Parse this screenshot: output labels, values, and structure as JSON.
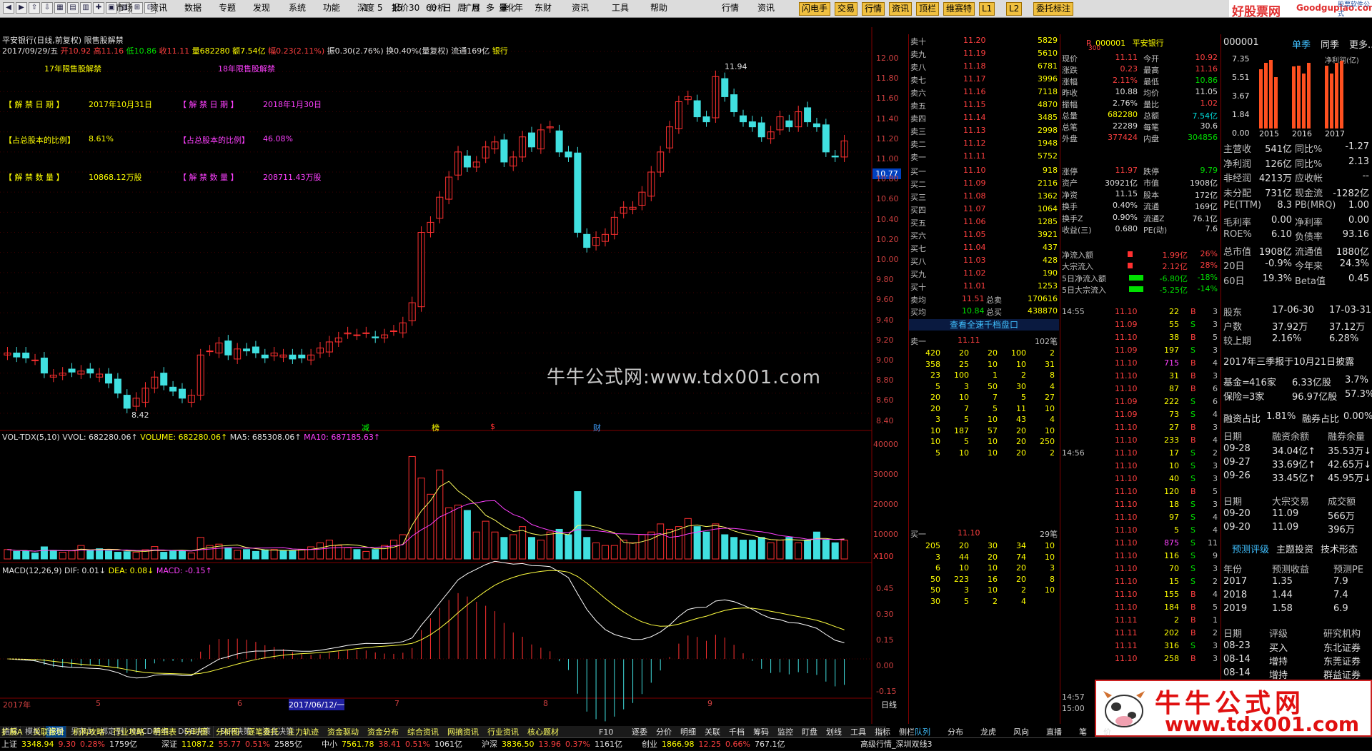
{
  "toolbar": {
    "menu": [
      "市场",
      "资讯",
      "数据",
      "专题",
      "发现",
      "系统",
      "功能",
      "深度",
      "报价",
      "分析",
      "扩展",
      "量化",
      "东财",
      "资讯",
      "工具",
      "帮助"
    ],
    "periods": [
      "1",
      "5",
      "15",
      "30",
      "60",
      "日",
      "周",
      "月",
      "多",
      "季",
      "年"
    ],
    "right_menu": [
      "行情",
      "资讯"
    ],
    "buttons": [
      "闪电手",
      "交易",
      "行情",
      "资讯",
      "顶栏",
      "维赛特",
      "L1",
      "L2",
      "委托标注"
    ],
    "logo_text": "好股票网",
    "logo_domain": "Goodgupiao.com",
    "logo_suffix": "股票软件公式"
  },
  "chart": {
    "title": "平安银行(日线,前复权) 限售股解禁",
    "info_line": {
      "date": "2017/09/29/五",
      "open": "开10.92",
      "high": "高11.16",
      "low": "低10.86",
      "close": "收11.11",
      "vol": "量682280",
      "amount": "额7.54亿",
      "change_amt": "幅0.23(2.11%)",
      "amp": "振0.30(2.76%)",
      "turnover": "换0.40%(量复权)",
      "float": "流通169亿",
      "sector": "银行"
    },
    "labels": {
      "l17": "17年限售股解禁",
      "l18": "18年限售股解禁"
    },
    "info_rows": [
      {
        "k1": "【 解 禁 日 期 】",
        "v1": "2017年10月31日",
        "k2": "【 解 禁 日 期 】",
        "v2": "2018年1月30日"
      },
      {
        "k1": "【占总股本的比例】",
        "v1": "8.61%",
        "k2": "【占总股本的比例】",
        "v2": "46.08%"
      },
      {
        "k1": "【 解 禁 数 量 】",
        "v1": "10868.12万股",
        "k2": "【 解 禁 数 量 】",
        "v2": "208711.43万股"
      }
    ],
    "watermark": "牛牛公式网:www.tdx001.com",
    "max_label": "11.94",
    "min_label": "8.42",
    "price_tag": "10.77",
    "price_axis": [
      "12.00",
      "11.80",
      "11.60",
      "11.40",
      "11.20",
      "11.00",
      "10.80",
      "10.60",
      "10.40",
      "10.20",
      "10.00",
      "9.80",
      "9.60",
      "9.40",
      "9.20",
      "9.00",
      "8.80",
      "8.60",
      "8.40"
    ],
    "event_marks": [
      {
        "t": "减",
        "c": "#00ff00"
      },
      {
        "t": "榜",
        "c": "#ffff00"
      },
      {
        "t": "$",
        "c": "#ff3030"
      },
      {
        "t": "财",
        "c": "#40a0ff"
      }
    ],
    "vol_header": {
      "name": "VOL-TDX(5,10)",
      "vvol": "VVOL: 682280.06↑",
      "volume": "VOLUME: 682280.06↑",
      "ma5": "MA5: 685308.06↑",
      "ma10": "MA10: 687185.63↑"
    },
    "vol_axis": [
      "40000",
      "30000",
      "20000",
      "10000"
    ],
    "vol_unit": "X100",
    "macd_header": {
      "name": "MACD(12,26,9)",
      "dif": "DIF: 0.01↓",
      "dea": "DEA: 0.08↓",
      "macd": "MACD: -0.15↑"
    },
    "macd_axis": [
      "0.45",
      "0.30",
      "0.15",
      "0.00",
      "-0.15"
    ],
    "date_axis": [
      "2017年",
      "5",
      "6",
      "2017/06/12/一",
      "7",
      "8",
      "9"
    ],
    "date_label": "日线"
  },
  "chart_data": {
    "type": "candlestick",
    "series": [
      {
        "name": "price",
        "close_series": [
          9.0,
          8.96,
          8.95,
          8.93,
          8.8,
          8.78,
          8.8,
          8.81,
          8.82,
          8.8,
          8.79,
          8.7,
          8.6,
          8.45,
          8.55,
          8.65,
          8.76,
          8.68,
          8.62,
          8.55,
          8.58,
          8.98,
          9.02,
          9.1,
          8.98,
          9.04,
          9.02,
          9.0,
          8.95,
          9.0,
          8.98,
          8.94,
          8.95,
          8.98,
          9.05,
          9.11,
          9.15,
          9.2,
          9.18,
          9.2,
          9.15,
          9.18,
          9.22,
          9.3,
          9.5,
          10.2,
          10.3,
          10.55,
          10.75,
          11.0,
          10.85,
          10.9,
          11.05,
          11.1,
          10.9,
          10.95,
          11.15,
          11.05,
          11.22,
          11.25,
          11.0,
          10.95,
          10.2,
          10.05,
          10.15,
          10.18,
          10.35,
          10.45,
          10.45,
          10.6,
          10.8,
          11.0,
          11.25,
          11.5,
          11.55,
          11.35,
          11.3,
          11.75,
          11.55,
          11.4,
          11.3,
          11.25,
          11.15,
          11.2,
          11.35,
          11.25,
          11.4,
          11.3,
          11.25,
          11.0,
          10.95,
          11.11
        ]
      }
    ],
    "volume_x100": [
      3500,
      2800,
      3000,
      2200,
      4500,
      3200,
      2500,
      3000,
      5000,
      3300,
      3800,
      3000,
      2500,
      2700,
      2500,
      3400,
      4600,
      2500,
      3000,
      2900,
      2200,
      8000,
      5000,
      5500,
      4200,
      3200,
      3500,
      2800,
      3300,
      3500,
      3000,
      3200,
      3600,
      4500,
      6000,
      7000,
      5000,
      4200,
      3500,
      2800,
      3500,
      5000,
      7000,
      9000,
      38000,
      30000,
      24000,
      33000,
      19000,
      20000,
      18000,
      10000,
      14000,
      10000,
      8000,
      9000,
      12000,
      8000,
      7000,
      10000,
      11000,
      9000,
      25000,
      8000,
      6000,
      5000,
      5000,
      7000,
      6000,
      9000,
      10000,
      13000,
      11000,
      12000,
      15000,
      12000,
      10000,
      13000,
      9000,
      8000,
      7000,
      7000,
      8000,
      6000,
      7000,
      8000,
      6000,
      7000,
      10000,
      7000,
      6000,
      7000
    ],
    "macd_y_range": [
      -0.2,
      0.5
    ],
    "volume_y_range": [
      0,
      45000
    ],
    "price_y_range": [
      8.3,
      12.1
    ]
  },
  "quote": {
    "code": "000001",
    "name": "平安银行",
    "code_prefix": "R",
    "code_sub": "300",
    "asks": [
      [
        "卖十",
        "11.20",
        "5829"
      ],
      [
        "卖九",
        "11.19",
        "5610"
      ],
      [
        "卖八",
        "11.18",
        "6781"
      ],
      [
        "卖七",
        "11.17",
        "3996"
      ],
      [
        "卖六",
        "11.16",
        "7118"
      ],
      [
        "卖五",
        "11.15",
        "4870"
      ],
      [
        "卖四",
        "11.14",
        "3485"
      ],
      [
        "卖三",
        "11.13",
        "2998"
      ],
      [
        "卖二",
        "11.12",
        "1948"
      ],
      [
        "卖一",
        "11.11",
        "5752"
      ]
    ],
    "bids": [
      [
        "买一",
        "11.10",
        "918"
      ],
      [
        "买二",
        "11.09",
        "2116"
      ],
      [
        "买三",
        "11.08",
        "1362"
      ],
      [
        "买四",
        "11.07",
        "1064"
      ],
      [
        "买五",
        "11.06",
        "1285"
      ],
      [
        "买六",
        "11.05",
        "3921"
      ],
      [
        "买七",
        "11.04",
        "437"
      ],
      [
        "买八",
        "11.03",
        "428"
      ],
      [
        "买九",
        "11.02",
        "190"
      ],
      [
        "买十",
        "11.01",
        "1253"
      ]
    ],
    "avg": [
      [
        "卖均",
        "11.51",
        "总卖",
        "170616"
      ],
      [
        "买均",
        "10.84",
        "总买",
        "438870"
      ]
    ],
    "link": "查看全速千档盘口",
    "q1_head": [
      "卖一",
      "11.11",
      "102笔"
    ],
    "q1_rows": [
      [
        "420",
        "20",
        "20",
        "100",
        "2"
      ],
      [
        "358",
        "25",
        "10",
        "10",
        "31"
      ],
      [
        "23",
        "100",
        "1",
        "2",
        "8"
      ],
      [
        "5",
        "3",
        "50",
        "30",
        "4"
      ],
      [
        "20",
        "10",
        "7",
        "5",
        "27"
      ],
      [
        "20",
        "7",
        "5",
        "11",
        "10"
      ],
      [
        "3",
        "5",
        "10",
        "43",
        "4"
      ],
      [
        "10",
        "187",
        "57",
        "20",
        "10"
      ],
      [
        "10",
        "5",
        "10",
        "20",
        "250"
      ],
      [
        "5",
        "10",
        "10",
        "20",
        "2"
      ]
    ],
    "q2_head": [
      "买一",
      "11.10",
      "29笔"
    ],
    "q2_rows": [
      [
        "205",
        "20",
        "30",
        "34",
        "10"
      ],
      [
        "3",
        "44",
        "20",
        "74",
        "10"
      ],
      [
        "6",
        "10",
        "10",
        "20",
        "3"
      ],
      [
        "50",
        "223",
        "16",
        "20",
        "8"
      ],
      [
        "50",
        "3",
        "10",
        "2",
        "10"
      ],
      [
        "30",
        "5",
        "2",
        "4",
        ""
      ]
    ]
  },
  "stats": [
    [
      "现价",
      "11.11",
      "今开",
      "10.92"
    ],
    [
      "涨跌",
      "0.23",
      "最高",
      "11.16"
    ],
    [
      "涨幅",
      "2.11%",
      "最低",
      "10.86"
    ],
    [
      "昨收",
      "10.88",
      "均价",
      "11.05"
    ],
    [
      "振幅",
      "2.76%",
      "量比",
      "1.02"
    ],
    [
      "总量",
      "682280",
      "总额",
      "7.54亿"
    ],
    [
      "总笔",
      "22289",
      "每笔",
      "30.6"
    ],
    [
      "外盘",
      "377424",
      "内盘",
      "304856"
    ],
    [
      "涨停",
      "11.97",
      "跌停",
      "9.79"
    ],
    [
      "资产",
      "30921亿",
      "市值",
      "1908亿"
    ],
    [
      "净资",
      "11.15",
      "股本",
      "172亿"
    ],
    [
      "换手",
      "0.40%",
      "流通",
      "169亿"
    ],
    [
      "换手Z",
      "0.90%",
      "流通Z",
      "76.1亿"
    ],
    [
      "收益(三)",
      "0.680",
      "PE(动)",
      "7.6"
    ]
  ],
  "flows": [
    [
      "净流入额",
      "1.99亿",
      "26%"
    ],
    [
      "大宗流入",
      "2.12亿",
      "28%"
    ],
    [
      "5日净流入额",
      "-6.80亿",
      "-18%"
    ],
    [
      "5日大宗流入",
      "-5.25亿",
      "-14%"
    ]
  ],
  "ticks": {
    "t1": "14:55",
    "t2": "14:56",
    "t3": "14:57",
    "t4": "15:00",
    "rows": [
      [
        "11.10",
        "22",
        "B",
        "3"
      ],
      [
        "11.09",
        "55",
        "S",
        "3"
      ],
      [
        "11.10",
        "38",
        "B",
        "5"
      ],
      [
        "11.09",
        "197",
        "S",
        "3"
      ],
      [
        "11.10",
        "715",
        "B",
        "4"
      ],
      [
        "11.10",
        "31",
        "B",
        "3"
      ],
      [
        "11.10",
        "87",
        "B",
        "6"
      ],
      [
        "11.09",
        "222",
        "S",
        "6"
      ],
      [
        "11.09",
        "73",
        "S",
        "4"
      ],
      [
        "11.10",
        "27",
        "B",
        "3"
      ],
      [
        "11.10",
        "233",
        "B",
        "4"
      ],
      [
        "11.10",
        "17",
        "S",
        "2"
      ],
      [
        "11.10",
        "10",
        "S",
        "3"
      ],
      [
        "11.10",
        "40",
        "S",
        "3"
      ],
      [
        "11.10",
        "120",
        "B",
        "5"
      ],
      [
        "11.10",
        "18",
        "S",
        "3"
      ],
      [
        "11.10",
        "97",
        "S",
        "4"
      ],
      [
        "11.10",
        "5",
        "S",
        "4"
      ],
      [
        "11.10",
        "875",
        "S",
        "11"
      ],
      [
        "11.10",
        "116",
        "S",
        "9"
      ],
      [
        "11.10",
        "70",
        "S",
        "3"
      ],
      [
        "11.10",
        "15",
        "S",
        "2"
      ],
      [
        "11.10",
        "155",
        "B",
        "4"
      ],
      [
        "11.10",
        "184",
        "B",
        "5"
      ],
      [
        "11.11",
        "2",
        "B",
        "1"
      ],
      [
        "11.11",
        "202",
        "B",
        "2"
      ],
      [
        "11.11",
        "316",
        "S",
        "3"
      ],
      [
        "11.10",
        "258",
        "B",
        "3"
      ]
    ]
  },
  "f10": {
    "code": "000001",
    "tabs": [
      "单季",
      "同季",
      "更多.."
    ],
    "bar_axis": [
      "7.35",
      "5.51",
      "3.67",
      "1.84",
      "0.00"
    ],
    "bar_legend": "净利润(亿)",
    "bar_years": [
      "2015",
      "2016",
      "2017"
    ],
    "bar_values": [
      6.2,
      6.9,
      7.2,
      5.4,
      6.5,
      6.6,
      5.8,
      6.9,
      6.6,
      5.8,
      6.9,
      7.1
    ],
    "fin": [
      [
        "主营收",
        "541亿",
        "同比%",
        "-1.27"
      ],
      [
        "净利润",
        "126亿",
        "同比%",
        "2.13"
      ],
      [
        "非经润",
        "4213万",
        "应收帐",
        "--"
      ],
      [
        "未分配",
        "731亿",
        "现金流",
        "-1282亿"
      ],
      [
        "PE(TTM)",
        "8.3",
        "PB(MRQ)",
        "1.00"
      ],
      [
        "毛利率",
        "0.00",
        "净利率",
        "0.00"
      ],
      [
        "ROE%",
        "6.10",
        "负债率",
        "93.16"
      ],
      [
        "总市值",
        "1908亿",
        "流通值",
        "1880亿"
      ],
      [
        "20日",
        "-0.9%",
        "今年来",
        "24.3%"
      ],
      [
        "60日",
        "19.3%",
        "Beta值",
        "0.45"
      ]
    ],
    "holders": [
      [
        "股东",
        "17-06-30",
        "17-03-31"
      ],
      [
        "户数",
        "37.92万",
        "37.12万"
      ],
      [
        "较上期",
        "2.16%",
        "6.28%"
      ]
    ],
    "report": "2017年三季报于10月21日披露",
    "funds": [
      [
        "基金=",
        "416家",
        "6.33亿股",
        "3.7%"
      ],
      [
        "保险=",
        "3家",
        "96.97亿股",
        "57.3%"
      ]
    ],
    "margin_ratio": [
      "融资占比",
      "1.81%",
      "融券占比",
      "0.00%"
    ],
    "margin_head": [
      "日期",
      "融资余额",
      "融券余量"
    ],
    "margin": [
      [
        "09-28",
        "34.04亿↑",
        "35.53万↓"
      ],
      [
        "09-27",
        "33.69亿↑",
        "42.65万↓"
      ],
      [
        "09-26",
        "33.45亿↑",
        "45.95万↓"
      ]
    ],
    "block_head": [
      "日期",
      "大宗交易",
      "成交额"
    ],
    "block": [
      [
        "09-20",
        "11.09",
        "566万"
      ],
      [
        "09-20",
        "11.09",
        "396万"
      ]
    ],
    "tabs2": [
      "预测评级",
      "主题投资",
      "技术形态"
    ],
    "fc_head": [
      "年份",
      "预测收益",
      "预测PE"
    ],
    "fc": [
      [
        "2017",
        "1.35",
        "7.9"
      ],
      [
        "2018",
        "1.44",
        "7.4"
      ],
      [
        "2019",
        "1.58",
        "6.9"
      ]
    ],
    "rt_head": [
      "日期",
      "评级",
      "研究机构"
    ],
    "rt": [
      [
        "08-23",
        "买入",
        "东北证券"
      ],
      [
        "08-14",
        "增持",
        "东莞证券"
      ],
      [
        "08-14",
        "增持",
        "群益证券"
      ]
    ]
  },
  "bottom_tabs1": [
    "指标",
    "模板",
    "管理",
    "另存为",
    "绑定到",
    "MACD基本",
    "DDE决策",
    "SUP决策",
    "资金决策"
  ],
  "bottom_tabs2": [
    "扩展A",
    "关联报价",
    "机构攻略",
    "行业攻略",
    "明细表",
    "分时图",
    "分析图",
    "逐笔委托",
    "主力轨迹",
    "资金驱动",
    "资金分布",
    "综合资讯",
    "网摘资讯",
    "行业资讯",
    "核心题材"
  ],
  "side_tabs": [
    "F10",
    "逐委",
    "分价",
    "明细",
    "关联",
    "千档",
    "筹码",
    "监控",
    "盯盘",
    "划线",
    "工具",
    "指标",
    "侧栏"
  ],
  "side_tabs2": [
    "队列",
    "分布",
    "龙虎",
    "风向",
    "直播",
    "笔",
    "价"
  ],
  "status": [
    {
      "n": "上证",
      "v": "3348.94",
      "c": "9.30",
      "p": "0.28%",
      "a": "1759亿"
    },
    {
      "n": "深证",
      "v": "11087.2",
      "c": "55.77",
      "p": "0.51%",
      "a": "2585亿"
    },
    {
      "n": "中小",
      "v": "7561.78",
      "c": "38.41",
      "p": "0.51%",
      "a": "1061亿"
    },
    {
      "n": "沪深",
      "v": "3836.50",
      "c": "13.96",
      "p": "0.37%",
      "a": "1161亿"
    },
    {
      "n": "创业",
      "v": "1866.98",
      "c": "12.25",
      "p": "0.66%",
      "a": "767.1亿"
    }
  ],
  "status_right": "高级行情_深圳双线3",
  "brand": {
    "title": "牛牛公式网",
    "url": "www.tdx001.com"
  }
}
